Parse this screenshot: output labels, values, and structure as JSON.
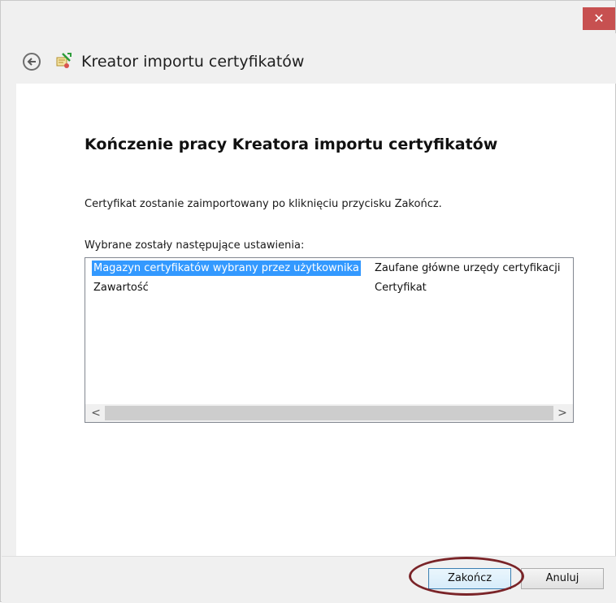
{
  "window": {
    "close_glyph": "✕",
    "title": "Kreator importu certyfikatów"
  },
  "content": {
    "heading": "Kończenie pracy Kreatora importu certyfikatów",
    "description": "Certyfikat zostanie zaimportowany po kliknięciu przycisku Zakończ.",
    "list_label": "Wybrane zostały następujące ustawienia:",
    "settings": [
      {
        "name": "Magazyn certyfikatów wybrany przez użytkownika",
        "value": "Zaufane główne urzędy certyfikacji",
        "selected": true
      },
      {
        "name": "Zawartość",
        "value": "Certyfikat",
        "selected": false
      }
    ],
    "scroll_left": "<",
    "scroll_right": ">"
  },
  "footer": {
    "finish_label": "Zakończ",
    "cancel_label": "Anuluj"
  },
  "colors": {
    "close_red": "#c75050",
    "selection_blue": "#3399ff",
    "annotation": "#7a2428"
  },
  "icons": {
    "back": "back-arrow-icon",
    "wizard": "certificate-wizard-icon"
  }
}
